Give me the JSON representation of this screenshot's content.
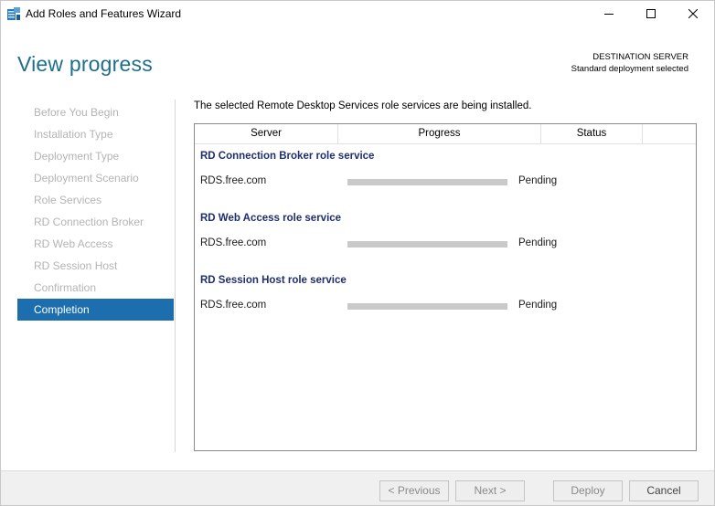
{
  "window": {
    "title": "Add Roles and Features Wizard",
    "icon": "server-manager-icon",
    "controls": [
      "minimize-icon",
      "maximize-icon",
      "close-icon"
    ]
  },
  "header": {
    "page_title": "View progress",
    "destination_label": "DESTINATION SERVER",
    "destination_value": "Standard deployment selected"
  },
  "nav": {
    "items": [
      {
        "label": "Before You Begin"
      },
      {
        "label": "Installation Type"
      },
      {
        "label": "Deployment Type"
      },
      {
        "label": "Deployment Scenario"
      },
      {
        "label": "Role Services"
      },
      {
        "label": "RD Connection Broker"
      },
      {
        "label": "RD Web Access"
      },
      {
        "label": "RD Session Host"
      },
      {
        "label": "Confirmation"
      },
      {
        "label": "Completion"
      }
    ],
    "active_index": 9
  },
  "main": {
    "intro": "The selected Remote Desktop Services role services are being installed.",
    "columns": {
      "server": "Server",
      "progress": "Progress",
      "status": "Status"
    },
    "groups": [
      {
        "title": "RD Connection Broker role service",
        "server": "RDS.free.com",
        "progress": 0,
        "status": "Pending"
      },
      {
        "title": "RD Web Access role service",
        "server": "RDS.free.com",
        "progress": 0,
        "status": "Pending"
      },
      {
        "title": "RD Session Host role service",
        "server": "RDS.free.com",
        "progress": 0,
        "status": "Pending"
      }
    ]
  },
  "footer": {
    "previous": "< Previous",
    "next": "Next >",
    "deploy": "Deploy",
    "cancel": "Cancel"
  },
  "colors": {
    "accent": "#1c6eae",
    "title": "#1f6f8b",
    "group_title": "#1f2f6e",
    "progress_track": "#c9c9c9"
  }
}
